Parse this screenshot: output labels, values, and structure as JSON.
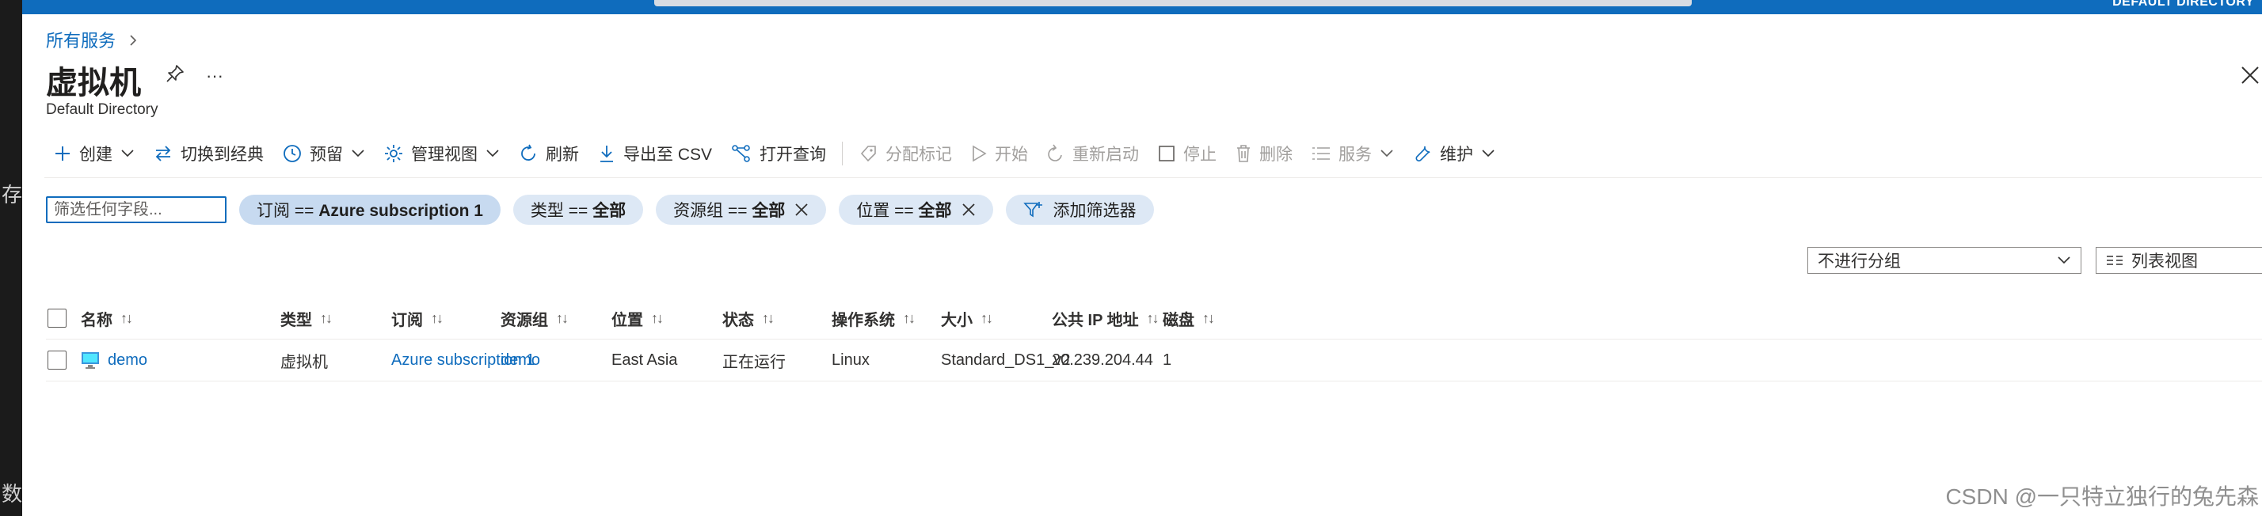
{
  "left_strip": {
    "char_top": "存",
    "char_bottom": "数"
  },
  "topbar": {
    "directory": "DEFAULT DIRECTORY"
  },
  "breadcrumb": {
    "item": "所有服务"
  },
  "header": {
    "title": "虚拟机",
    "subtitle": "Default Directory",
    "more": "···"
  },
  "toolbar": {
    "create": "创建",
    "switch_classic": "切换到经典",
    "reserve": "预留",
    "manage_view": "管理视图",
    "refresh": "刷新",
    "export_csv": "导出至 CSV",
    "open_query": "打开查询",
    "assign_tags": "分配标记",
    "start": "开始",
    "restart": "重新启动",
    "stop": "停止",
    "delete": "删除",
    "services": "服务",
    "maintenance": "维护"
  },
  "filters": {
    "search_placeholder": "筛选任何字段...",
    "subscription_prefix": "订阅 == ",
    "subscription_value": "Azure subscription 1",
    "type_prefix": "类型 == ",
    "type_value": "全部",
    "rg_prefix": "资源组 == ",
    "rg_value": "全部",
    "location_prefix": "位置 == ",
    "location_value": "全部",
    "add_filter": "添加筛选器"
  },
  "grouping": {
    "selected": "不进行分组"
  },
  "view": {
    "selected": "列表视图"
  },
  "table": {
    "sort_glyph": "↑↓",
    "columns": [
      "名称",
      "类型",
      "订阅",
      "资源组",
      "位置",
      "状态",
      "操作系统",
      "大小",
      "公共 IP 地址",
      "磁盘"
    ],
    "rows": [
      {
        "name": "demo",
        "type": "虚拟机",
        "subscription": "Azure subscription 1",
        "resource_group": "demo",
        "location": "East Asia",
        "status": "正在运行",
        "os": "Linux",
        "size": "Standard_DS1_v2",
        "public_ip": "20.239.204.44",
        "disks": "1"
      }
    ]
  },
  "watermark": "CSDN @一只特立独行的兔先森",
  "colors": {
    "accent": "#0f6cbd",
    "pill_bg": "#dde8f5",
    "text": "#323130"
  }
}
